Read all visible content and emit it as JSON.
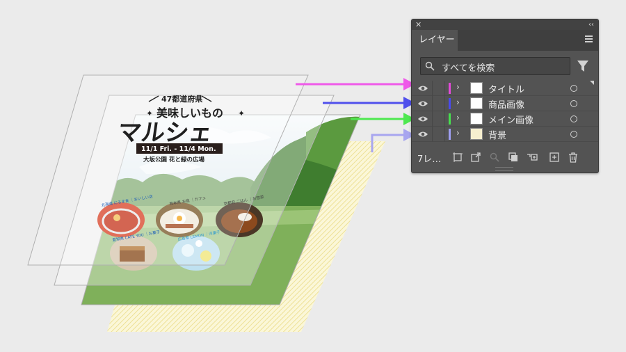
{
  "poster": {
    "prefecture": "47都道府県",
    "catchline": "美味しいもの",
    "headline": "マルシェ",
    "dates": "11/1 Fri. - 11/4 Mon.",
    "venue": "大坂公園 花と緑の広場",
    "shops": [
      "北海道 にるま食 ｜おいしい店",
      "熊本県 お庭 ｜カフェ",
      "京都府 ごはん ｜お惣菜",
      "愛知県 CAFE YOU ｜お菓子",
      "広島県 LEMON ｜洋菓子"
    ]
  },
  "panel": {
    "tab_label": "レイヤー",
    "search_placeholder": "すべてを検索",
    "layers": [
      {
        "name": "タイトル",
        "color": "#e44ad9"
      },
      {
        "name": "商品画像",
        "color": "#4a4aef"
      },
      {
        "name": "メイン画像",
        "color": "#46e04e"
      },
      {
        "name": "背景",
        "color": "#9f9ff2"
      }
    ],
    "layer_count": "7レ…"
  },
  "arrow_colors": {
    "title": "#ef5ae9",
    "products": "#5050ec",
    "main_image": "#4ee84f",
    "background": "#a8a6ef"
  }
}
